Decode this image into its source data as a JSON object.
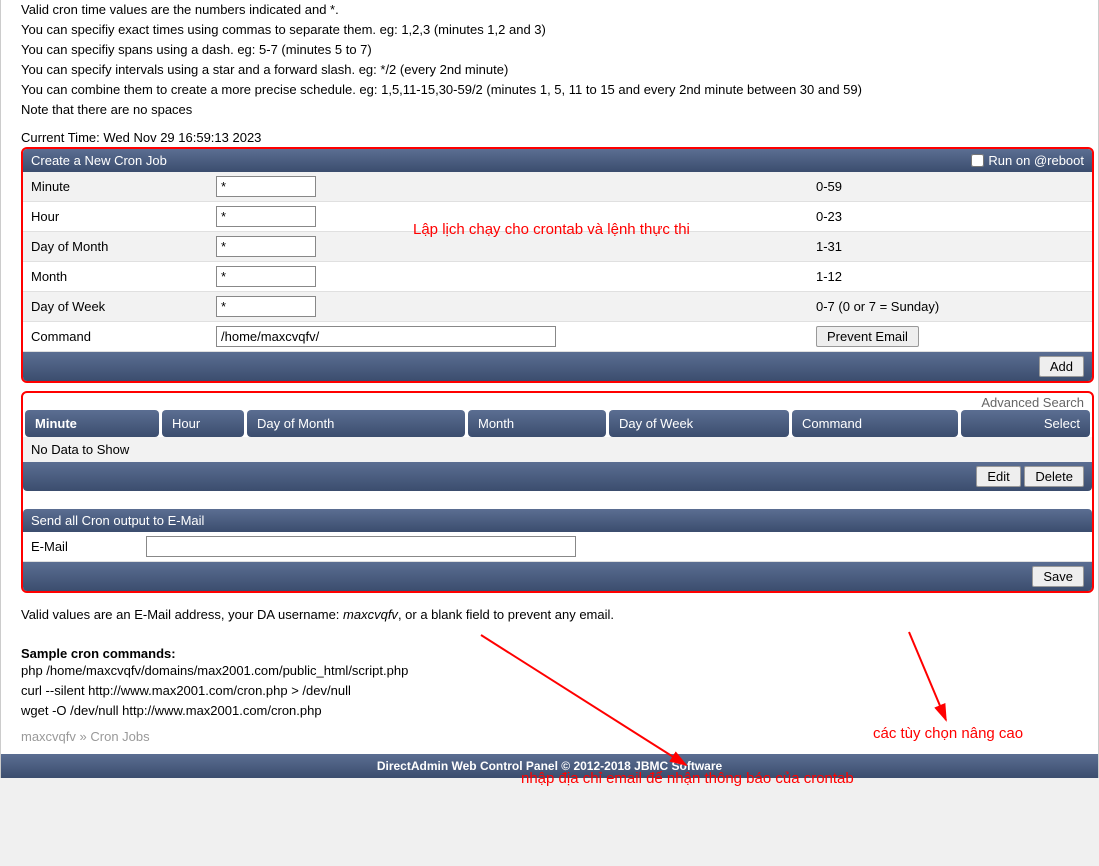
{
  "help": {
    "line1": "Valid cron time values are the numbers indicated and *.",
    "line2": "You can specifiy exact times using commas to separate them. eg: 1,2,3 (minutes 1,2 and 3)",
    "line3": "You can specifiy spans using a dash. eg: 5-7 (minutes 5 to 7)",
    "line4": "You can specify intervals using a star and a forward slash. eg: */2 (every 2nd minute)",
    "line5": "You can combine them to create a more precise schedule. eg: 1,5,11-15,30-59/2 (minutes 1, 5, 11 to 15 and every 2nd minute between 30 and 59)",
    "line6": "Note that there are no spaces"
  },
  "current_time": "Current Time: Wed Nov 29 16:59:13 2023",
  "create": {
    "title": "Create a New Cron Job",
    "reboot_label": "Run on @reboot",
    "rows": {
      "minute": {
        "label": "Minute",
        "value": "*",
        "range": "0-59"
      },
      "hour": {
        "label": "Hour",
        "value": "*",
        "range": "0-23"
      },
      "dom": {
        "label": "Day of Month",
        "value": "*",
        "range": "1-31"
      },
      "month": {
        "label": "Month",
        "value": "*",
        "range": "1-12"
      },
      "dow": {
        "label": "Day of Week",
        "value": "*",
        "range": "0-7 (0 or 7 = Sunday)"
      },
      "command": {
        "label": "Command",
        "value": "/home/maxcvqfv/",
        "prevent_label": "Prevent Email"
      }
    },
    "add_label": "Add"
  },
  "annotations": {
    "schedule": "Lập lịch chạy cho crontab và lệnh thực thi",
    "adv_options": "các tùy chọn nâng cao",
    "email_note": "nhập địa chỉ email để nhận thông báo của crontab"
  },
  "adv_search": "Advanced Search",
  "jobs_table": {
    "headers": {
      "minute": "Minute",
      "hour": "Hour",
      "dom": "Day of Month",
      "month": "Month",
      "dow": "Day of Week",
      "command": "Command",
      "select": "Select"
    },
    "no_data": "No Data to Show",
    "edit_label": "Edit",
    "delete_label": "Delete"
  },
  "email_panel": {
    "title": "Send all Cron output to E-Mail",
    "label": "E-Mail",
    "value": "",
    "save_label": "Save"
  },
  "valid_email": {
    "prefix": "Valid values are an E-Mail address, your DA username: ",
    "username": "maxcvqfv",
    "suffix": ", or a blank field to prevent any email."
  },
  "sample": {
    "title": "Sample cron commands:",
    "line1": "php /home/maxcvqfv/domains/max2001.com/public_html/script.php",
    "line2": "curl --silent http://www.max2001.com/cron.php > /dev/null",
    "line3": "wget -O /dev/null http://www.max2001.com/cron.php"
  },
  "breadcrumb": {
    "user": "maxcvqfv",
    "sep": " » ",
    "page": "Cron Jobs"
  },
  "footer": "DirectAdmin Web Control Panel © 2012-2018 JBMC Software"
}
